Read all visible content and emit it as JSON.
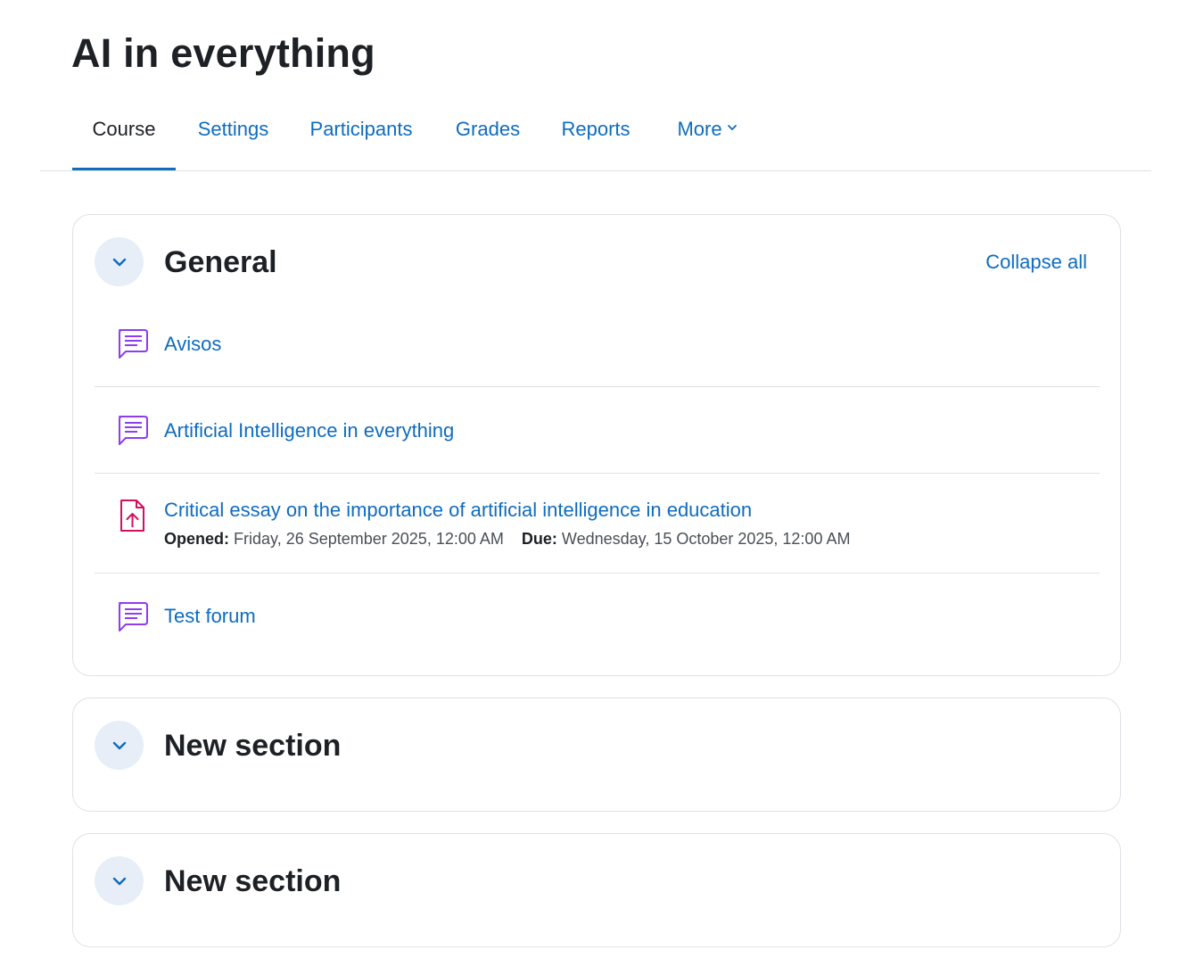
{
  "page": {
    "title": "AI in everything"
  },
  "nav": {
    "tabs": [
      {
        "label": "Course",
        "active": true
      },
      {
        "label": "Settings"
      },
      {
        "label": "Participants"
      },
      {
        "label": "Grades"
      },
      {
        "label": "Reports"
      },
      {
        "label": "More"
      }
    ]
  },
  "sections": [
    {
      "title": "General",
      "collapse_all": "Collapse all",
      "activities": [
        {
          "name": "Avisos",
          "icon": "forum-icon"
        },
        {
          "name": "Artificial Intelligence in everything",
          "icon": "forum-icon"
        },
        {
          "name": "Critical essay on the importance of artificial intelligence in education",
          "icon": "assignment-upload-icon",
          "opened_label": "Opened:",
          "opened_value": "Friday, 26 September 2025, 12:00 AM",
          "due_label": "Due:",
          "due_value": "Wednesday, 15 October 2025, 12:00 AM"
        },
        {
          "name": "Test forum",
          "icon": "forum-icon"
        }
      ]
    },
    {
      "title": "New section"
    },
    {
      "title": "New section"
    }
  ],
  "colors": {
    "link": "#0f6cbf",
    "text": "#1d2125",
    "forum_icon": "#8f3ded",
    "assignment_icon": "#d1115f",
    "toggle_bg": "#e7eef8",
    "border": "#dee2e6"
  }
}
